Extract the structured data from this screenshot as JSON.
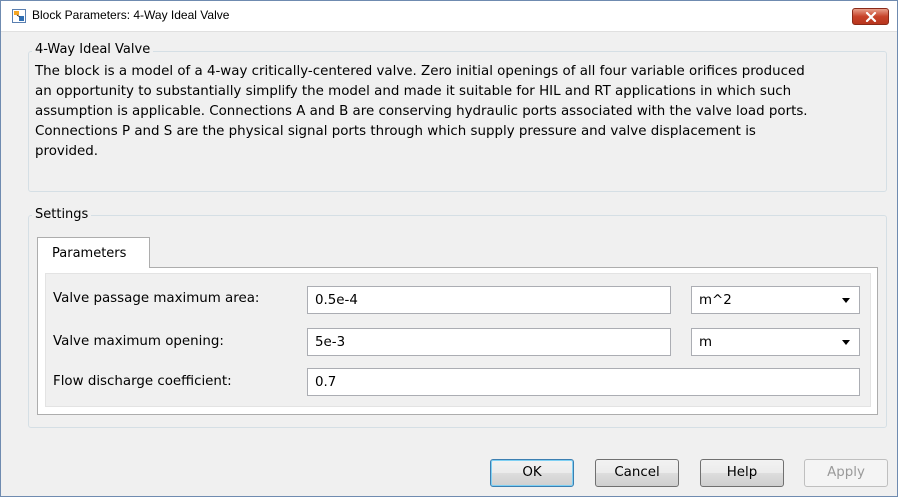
{
  "window": {
    "title": "Block Parameters: 4-Way Ideal Valve"
  },
  "block_group": {
    "label": "4-Way Ideal Valve",
    "description": "The block is a model of a 4-way critically-centered valve. Zero initial openings of all four variable orifices produced\nan opportunity to substantially simplify the model and made it suitable for HIL and RT applications in which such\nassumption is applicable. Connections A and B are conserving hydraulic ports associated with the valve load ports.\nConnections P and S are the physical signal ports through which supply pressure and valve displacement is\nprovided."
  },
  "settings": {
    "label": "Settings",
    "tabs": [
      {
        "label": "Parameters"
      }
    ],
    "params": [
      {
        "label": "Valve passage maximum area:",
        "value": "0.5e-4",
        "unit": "m^2"
      },
      {
        "label": "Valve maximum opening:",
        "value": "5e-3",
        "unit": "m"
      },
      {
        "label": "Flow discharge coefficient:",
        "value": "0.7"
      }
    ]
  },
  "buttons": {
    "ok": "OK",
    "cancel": "Cancel",
    "help": "Help",
    "apply": "Apply"
  }
}
